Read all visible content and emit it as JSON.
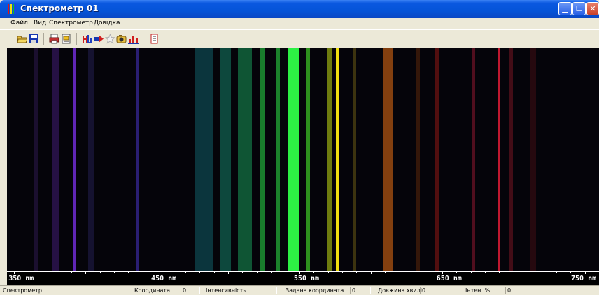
{
  "window": {
    "title": "Спектрометр 01",
    "min_glyph": "▁",
    "max_glyph": "☐",
    "close_glyph": "✕"
  },
  "menu": [
    "Файл",
    "Вид",
    "Спектрометр",
    "Довідка"
  ],
  "toolbar_icons": [
    "open-folder-icon",
    "save-icon",
    "print-icon",
    "print-preview-icon",
    "spectrum-icon",
    "arrow-right-icon",
    "star-icon",
    "camera-icon",
    "chart-icon",
    "info-icon"
  ],
  "spectrum": {
    "background": "#05040a",
    "lines": [
      {
        "nm": 365,
        "width": 6,
        "color": "#2a1848",
        "opacity": 0.6
      },
      {
        "nm": 379,
        "width": 10,
        "color": "#3c1a6a",
        "opacity": 0.6
      },
      {
        "nm": 392,
        "width": 4,
        "color": "#6a2ac8",
        "opacity": 0.9
      },
      {
        "nm": 404,
        "width": 8,
        "color": "#1c1840",
        "opacity": 0.7
      },
      {
        "nm": 436,
        "width": 4,
        "color": "#3a2aa0",
        "opacity": 0.7
      },
      {
        "nm": 483,
        "width": 26,
        "color": "#0e4a52",
        "opacity": 0.7
      },
      {
        "nm": 498,
        "width": 16,
        "color": "#0f5a4a",
        "opacity": 0.8
      },
      {
        "nm": 512,
        "width": 20,
        "color": "#116a3e",
        "opacity": 0.8
      },
      {
        "nm": 524,
        "width": 6,
        "color": "#1c8a30",
        "opacity": 0.9
      },
      {
        "nm": 535,
        "width": 6,
        "color": "#1f9030",
        "opacity": 0.9
      },
      {
        "nm": 546,
        "width": 16,
        "color": "#2df044",
        "opacity": 1.0
      },
      {
        "nm": 556,
        "width": 6,
        "color": "#33a020",
        "opacity": 0.9
      },
      {
        "nm": 571,
        "width": 6,
        "color": "#7a8a10",
        "opacity": 0.9
      },
      {
        "nm": 577,
        "width": 5,
        "color": "#f0e010",
        "opacity": 1.0
      },
      {
        "nm": 589,
        "width": 4,
        "color": "#4a4010",
        "opacity": 0.8
      },
      {
        "nm": 612,
        "width": 14,
        "color": "#9a4a10",
        "opacity": 0.85
      },
      {
        "nm": 633,
        "width": 6,
        "color": "#3a1a0a",
        "opacity": 0.9
      },
      {
        "nm": 646,
        "width": 6,
        "color": "#5a1010",
        "opacity": 0.9
      },
      {
        "nm": 672,
        "width": 4,
        "color": "#5a1020",
        "opacity": 0.9
      },
      {
        "nm": 690,
        "width": 3,
        "color": "#c01830",
        "opacity": 1.0
      },
      {
        "nm": 698,
        "width": 6,
        "color": "#4a0e18",
        "opacity": 0.9
      },
      {
        "nm": 714,
        "width": 8,
        "color": "#2a0a10",
        "opacity": 0.9
      }
    ]
  },
  "ruler": {
    "min_nm": 345,
    "max_nm": 760,
    "labels": [
      {
        "nm": 350,
        "text": "350 nm"
      },
      {
        "nm": 450,
        "text": "450 nm"
      },
      {
        "nm": 550,
        "text": "550 nm"
      },
      {
        "nm": 650,
        "text": "650 nm"
      },
      {
        "nm": 750,
        "text": "750 nm"
      }
    ]
  },
  "status": {
    "mode": "Спектрометр",
    "coord_label": "Координата",
    "coord_value": "0",
    "intensity_label": "Інтенсивність",
    "intensity_value": "",
    "set_coord_label": "Задана координата",
    "set_coord_value": "0",
    "wavelength_label": "Довжина хвилі",
    "wavelength_value": "0",
    "inten_pct_label": "Інтен. %",
    "inten_pct_value": "0"
  }
}
